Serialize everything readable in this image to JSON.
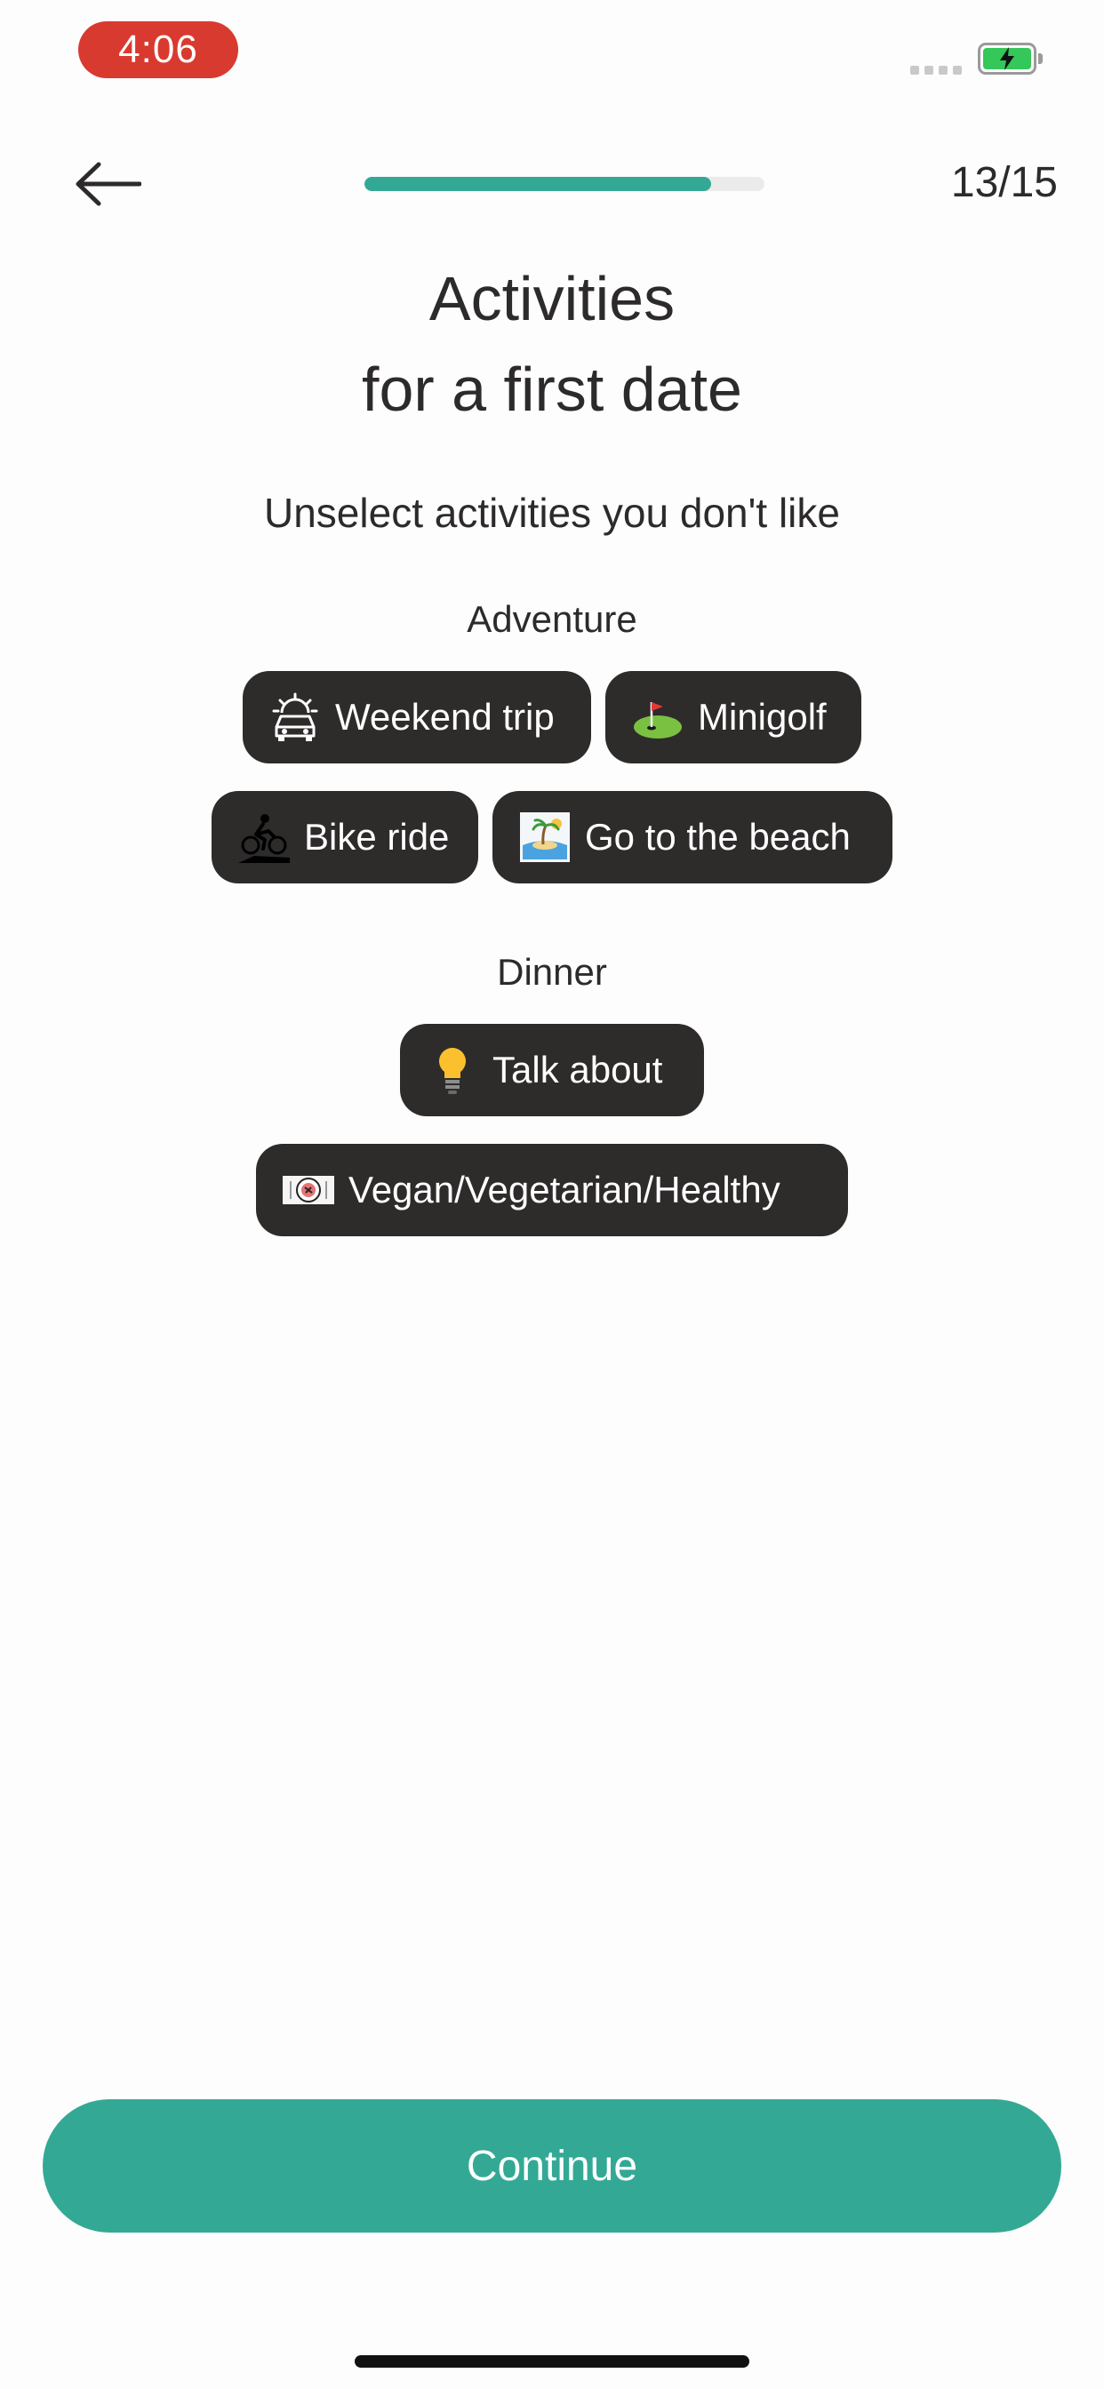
{
  "status_bar": {
    "time": "4:06",
    "battery_color": "#34c759",
    "time_pill_color": "#d93a2f"
  },
  "header": {
    "back_icon": "arrow-left-icon",
    "progress": {
      "current": 13,
      "total": 15,
      "fraction": 0.867
    },
    "step_label": "13/15"
  },
  "title_line1": "Activities",
  "title_line2": "for a first date",
  "subtitle": "Unselect activities you don't like",
  "sections": [
    {
      "label": "Adventure",
      "chips": [
        {
          "label": "Weekend trip",
          "icon": "car-sunrise-icon"
        },
        {
          "label": "Minigolf",
          "icon": "golf-green-icon"
        },
        {
          "label": "Bike ride",
          "icon": "cyclist-icon"
        },
        {
          "label": "Go to the beach",
          "icon": "beach-island-icon"
        }
      ]
    },
    {
      "label": "Dinner",
      "chips": [
        {
          "label": "Talk about",
          "icon": "light-bulb-icon"
        },
        {
          "label": "Vegan/Vegetarian/Healthy",
          "icon": "salad-plate-icon"
        }
      ]
    }
  ],
  "continue_label": "Continue",
  "colors": {
    "accent": "#33a995",
    "chip_background": "#2e2b2b",
    "text": "#2d2a2a",
    "background": "#fdfdfd"
  }
}
